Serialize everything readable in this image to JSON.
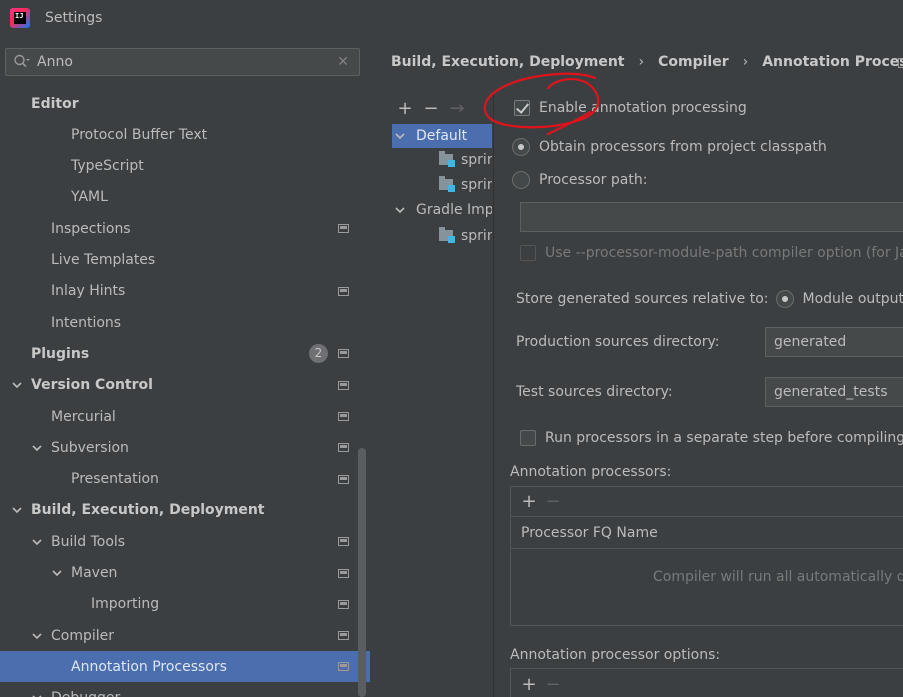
{
  "window": {
    "title": "Settings"
  },
  "search": {
    "value": "Anno"
  },
  "tree": [
    {
      "label": "Editor",
      "bold": true,
      "indent": 0,
      "arrow": "none",
      "page": false
    },
    {
      "label": "Protocol Buffer Text",
      "bold": false,
      "indent": 2,
      "arrow": "none",
      "page": false
    },
    {
      "label": "TypeScript",
      "bold": false,
      "indent": 2,
      "arrow": "none",
      "page": false
    },
    {
      "label": "YAML",
      "bold": false,
      "indent": 2,
      "arrow": "none",
      "page": false
    },
    {
      "label": "Inspections",
      "bold": false,
      "indent": 1,
      "arrow": "none",
      "page": true
    },
    {
      "label": "Live Templates",
      "bold": false,
      "indent": 1,
      "arrow": "none",
      "page": false
    },
    {
      "label": "Inlay Hints",
      "bold": false,
      "indent": 1,
      "arrow": "none",
      "page": true
    },
    {
      "label": "Intentions",
      "bold": false,
      "indent": 1,
      "arrow": "none",
      "page": false
    },
    {
      "label": "Plugins",
      "bold": true,
      "indent": 0,
      "arrow": "none",
      "page": true,
      "badge": "2"
    },
    {
      "label": "Version Control",
      "bold": true,
      "indent": 0,
      "arrow": "down",
      "page": true
    },
    {
      "label": "Mercurial",
      "bold": false,
      "indent": 1,
      "arrow": "none",
      "page": true
    },
    {
      "label": "Subversion",
      "bold": false,
      "indent": 1,
      "arrow": "down",
      "page": true
    },
    {
      "label": "Presentation",
      "bold": false,
      "indent": 2,
      "arrow": "none",
      "page": true
    },
    {
      "label": "Build, Execution, Deployment",
      "bold": true,
      "indent": 0,
      "arrow": "down",
      "page": false
    },
    {
      "label": "Build Tools",
      "bold": false,
      "indent": 1,
      "arrow": "down",
      "page": true
    },
    {
      "label": "Maven",
      "bold": false,
      "indent": 2,
      "arrow": "down",
      "page": true
    },
    {
      "label": "Importing",
      "bold": false,
      "indent": 3,
      "arrow": "none",
      "page": true
    },
    {
      "label": "Compiler",
      "bold": false,
      "indent": 1,
      "arrow": "down",
      "page": true
    },
    {
      "label": "Annotation Processors",
      "bold": false,
      "indent": 2,
      "arrow": "none",
      "page": true,
      "selected": true
    },
    {
      "label": "Debugger",
      "bold": false,
      "indent": 1,
      "arrow": "down",
      "page": false
    }
  ],
  "breadcrumb": [
    "Build, Execution, Deployment",
    "Compiler",
    "Annotation Processors"
  ],
  "profiles": {
    "items": [
      {
        "label": "Default",
        "selected": true,
        "module": false,
        "expanded": true
      },
      {
        "label": "sprin",
        "selected": false,
        "module": true
      },
      {
        "label": "sprin",
        "selected": false,
        "module": true
      },
      {
        "label": "Gradle Imp",
        "selected": false,
        "module": false,
        "expanded": true
      },
      {
        "label": "sprin",
        "selected": false,
        "module": true
      }
    ]
  },
  "form": {
    "enable_annotation": "Enable annotation processing",
    "obtain_classpath": "Obtain processors from project classpath",
    "processor_path": "Processor path:",
    "use_module_path": "Use --processor-module-path compiler option (for Ja",
    "store_generated": "Store generated sources relative to:",
    "module_output": "Module output c",
    "production_dir_label": "Production sources directory:",
    "production_dir_value": "generated",
    "test_dir_label": "Test sources directory:",
    "test_dir_value": "generated_tests",
    "run_separate": "Run processors in a separate step before compiling j",
    "annotation_processors_label": "Annotation processors:",
    "processor_fq_name": "Processor FQ Name",
    "empty_text": "Compiler will run all automatically d",
    "annotation_options_label": "Annotation processor options:"
  },
  "icons": {
    "add": "+",
    "remove": "−",
    "move": "→"
  },
  "colors": {
    "selection": "#4b6eaf",
    "background": "#3c3f41",
    "annotation_circle": "#e0131c"
  }
}
